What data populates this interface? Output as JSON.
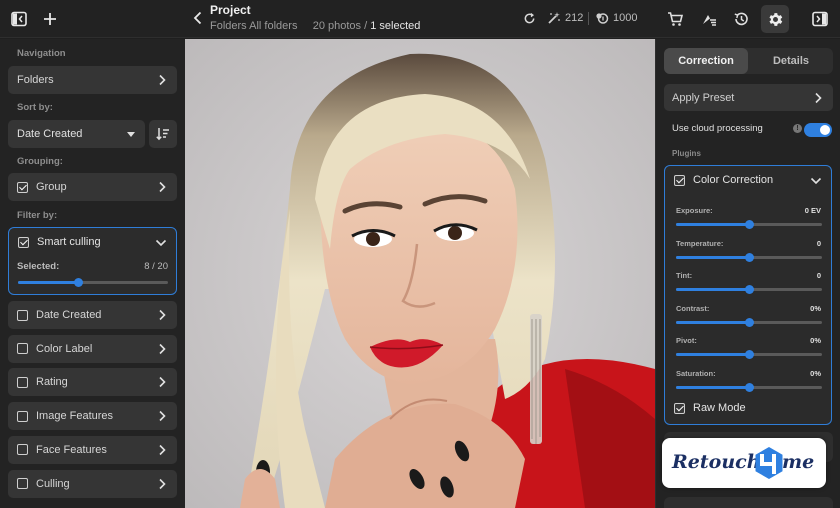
{
  "topbar": {
    "title": "Project",
    "breadcrumb": "Folders",
    "folder": "All folders",
    "photos_count": "20 photos",
    "separator": "/",
    "selected_count": "1 selected",
    "credits_edit": "212",
    "credits_total": "1000"
  },
  "sidebar": {
    "navigation_label": "Navigation",
    "folders_label": "Folders",
    "sort_label": "Sort by:",
    "sort_value": "Date Created",
    "grouping_label": "Grouping:",
    "group_label": "Group",
    "filter_label": "Filter by:",
    "smart_culling": {
      "label": "Smart culling",
      "selected_label": "Selected:",
      "selected_value": "8 / 20",
      "selected_fraction": 0.4
    },
    "filters": [
      {
        "label": "Date Created"
      },
      {
        "label": "Color Label"
      },
      {
        "label": "Rating"
      },
      {
        "label": "Image Features"
      },
      {
        "label": "Face Features"
      },
      {
        "label": "Culling"
      }
    ]
  },
  "panel": {
    "tabs": [
      {
        "label": "Correction"
      },
      {
        "label": "Details"
      }
    ],
    "apply_preset": "Apply Preset",
    "cloud_processing": "Use cloud processing",
    "cloud_enabled": true,
    "plugins_label": "Plugins",
    "color_correction": {
      "title": "Color Correction",
      "sliders": [
        {
          "label": "Exposure:",
          "value": "0 EV",
          "level": 0.5
        },
        {
          "label": "Temperature:",
          "value": "0",
          "level": 0.5
        },
        {
          "label": "Tint:",
          "value": "0",
          "level": 0.5
        },
        {
          "label": "Contrast:",
          "value": "0%",
          "level": 0.5
        },
        {
          "label": "Pivot:",
          "value": "0%",
          "level": 0.5
        },
        {
          "label": "Saturation:",
          "value": "0%",
          "level": 0.5
        }
      ],
      "raw_mode": "Raw Mode"
    }
  },
  "logo": {
    "text_left": "Retouch",
    "text_right": "me"
  },
  "colors": {
    "accent": "#2f80e0",
    "panel": "#232323",
    "row": "#353535"
  }
}
